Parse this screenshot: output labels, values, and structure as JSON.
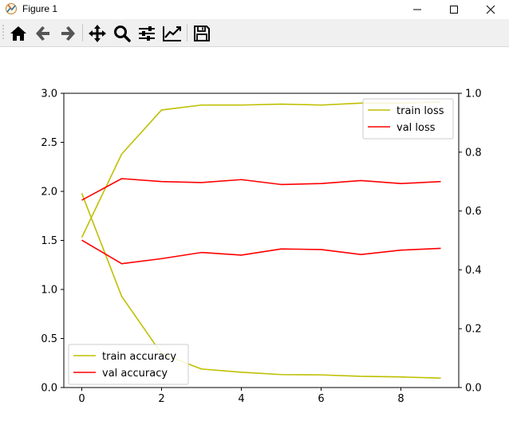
{
  "window": {
    "title": "Figure 1"
  },
  "toolbar": {
    "buttons": [
      {
        "name": "home",
        "icon": "home-icon"
      },
      {
        "name": "back",
        "icon": "arrow-left-icon"
      },
      {
        "name": "forward",
        "icon": "arrow-right-icon"
      },
      {
        "name": "pan",
        "icon": "move-icon"
      },
      {
        "name": "zoom",
        "icon": "search-icon"
      },
      {
        "name": "configure-subplots",
        "icon": "sliders-icon"
      },
      {
        "name": "edit-axis",
        "icon": "line-chart-icon"
      },
      {
        "name": "save",
        "icon": "save-icon"
      }
    ]
  },
  "colors": {
    "train": "#bfbf00",
    "val": "#ff0000",
    "axis": "#000000"
  },
  "chart_data": {
    "type": "line",
    "x": [
      0,
      1,
      2,
      3,
      4,
      5,
      6,
      7,
      8,
      9
    ],
    "xlim": [
      -0.45,
      9.45
    ],
    "xticks": [
      "0",
      "2",
      "4",
      "6",
      "8"
    ],
    "left_axis": {
      "ylim": [
        0,
        3.0
      ],
      "ticks": [
        "0.0",
        "0.5",
        "1.0",
        "1.5",
        "2.0",
        "2.5",
        "3.0"
      ],
      "series": [
        {
          "name": "train loss",
          "color": "#bfbf00",
          "values": [
            1.53,
            2.38,
            2.83,
            2.88,
            2.88,
            2.89,
            2.88,
            2.9,
            2.9,
            2.91
          ]
        },
        {
          "name": "val loss",
          "color": "#ff0000",
          "values": [
            1.91,
            2.13,
            2.1,
            2.09,
            2.12,
            2.07,
            2.08,
            2.11,
            2.08,
            2.1
          ]
        }
      ],
      "legend": "upper right"
    },
    "right_axis": {
      "ylim": [
        0,
        1.0
      ],
      "ticks": [
        "0.0",
        "0.2",
        "0.4",
        "0.6",
        "0.8",
        "1.0"
      ],
      "series": [
        {
          "name": "train accuracy",
          "color": "#bfbf00",
          "values": [
            0.66,
            0.31,
            0.115,
            0.063,
            0.052,
            0.044,
            0.043,
            0.038,
            0.036,
            0.032
          ]
        },
        {
          "name": "val accuracy",
          "color": "#ff0000",
          "values": [
            0.501,
            0.421,
            0.438,
            0.459,
            0.45,
            0.471,
            0.469,
            0.452,
            0.467,
            0.473
          ]
        }
      ],
      "legend": "lower left"
    }
  }
}
